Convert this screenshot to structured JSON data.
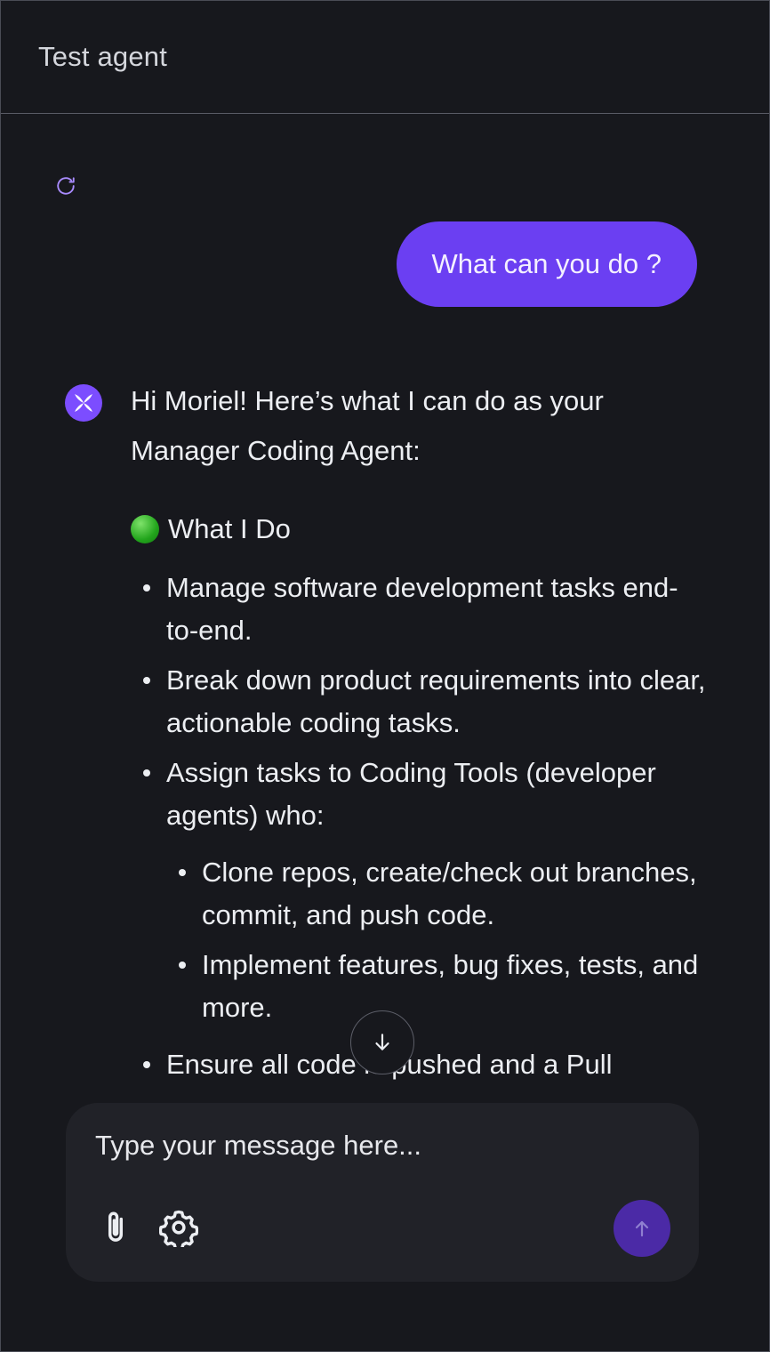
{
  "window": {
    "title": "Test agent"
  },
  "conversation": {
    "user_message": "What can you do ?",
    "agent_message": {
      "intro": "Hi Moriel! Here’s what I can do as your Manager Coding Agent:",
      "section_heading": "What I Do",
      "section_icon": "green-circle-emoji",
      "bullets": [
        "Manage software development tasks end-to-end.",
        "Break down product requirements into clear, actionable coding tasks.",
        "Assign tasks to Coding Tools (developer agents) who:"
      ],
      "sub_bullets": [
        "Clone repos, create/check out branches, commit, and push code.",
        "Implement features, bug fixes, tests, and more."
      ],
      "last_bullet": "Ensure all code is pushed and a Pull"
    }
  },
  "composer": {
    "placeholder": "Type your message here...",
    "value": ""
  },
  "icons": {
    "refresh": "refresh-icon",
    "avatar": "agent-avatar-logo",
    "scroll": "arrow-down-icon",
    "attach": "paperclip-icon",
    "settings": "gear-icon",
    "send": "arrow-up-icon"
  },
  "colors": {
    "background": "#17181d",
    "user_bubble": "#6b3ff2",
    "accent": "#7c4dff",
    "send_button": "#4b2aa6",
    "composer": "#212228"
  }
}
